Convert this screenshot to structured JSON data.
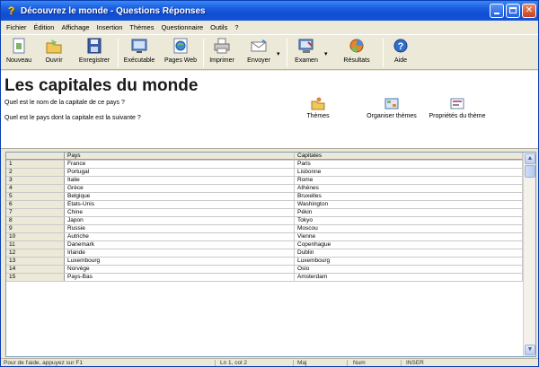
{
  "window": {
    "title": "Découvrez le monde - Questions Réponses",
    "icon": "question-mark-icon"
  },
  "menu": [
    "Fichier",
    "Édition",
    "Affichage",
    "Insertion",
    "Thèmes",
    "Questionnaire",
    "Outils",
    "?"
  ],
  "toolbar": {
    "buttons": [
      {
        "label": "Nouveau",
        "icon": "new-document-icon"
      },
      {
        "label": "Ouvrir",
        "icon": "open-folder-icon"
      },
      {
        "label": "Enregistrer",
        "icon": "save-disk-icon"
      },
      {
        "label": "Exécutable",
        "icon": "executable-icon"
      },
      {
        "label": "Pages Web",
        "icon": "web-pages-icon"
      },
      {
        "label": "Imprimer",
        "icon": "printer-icon"
      },
      {
        "label": "Envoyer",
        "icon": "send-mail-icon"
      },
      {
        "label": "Examen",
        "icon": "exam-icon"
      },
      {
        "label": "Résultats",
        "icon": "results-icon"
      },
      {
        "label": "Aide",
        "icon": "help-icon"
      }
    ]
  },
  "header": {
    "title": "Les capitales du monde",
    "question1": "Quel est le nom de la capitale de ce pays ?",
    "question2": "Quel est le pays dont la capitale est la suivante ?",
    "buttons": [
      {
        "label": "Thèmes",
        "icon": "themes-icon"
      },
      {
        "label": "Organiser thèmes",
        "icon": "organize-themes-icon"
      },
      {
        "label": "Propriétés du thème",
        "icon": "theme-properties-icon"
      }
    ]
  },
  "grid": {
    "columns": [
      "",
      "Pays",
      "Capitales"
    ],
    "rows": [
      [
        "1",
        "France",
        "Paris"
      ],
      [
        "2",
        "Portugal",
        "Lisbonne"
      ],
      [
        "3",
        "Italie",
        "Rome"
      ],
      [
        "4",
        "Grèce",
        "Athènes"
      ],
      [
        "5",
        "Belgique",
        "Bruxelles"
      ],
      [
        "6",
        "États-Unis",
        "Washington"
      ],
      [
        "7",
        "Chine",
        "Pékin"
      ],
      [
        "8",
        "Japon",
        "Tokyo"
      ],
      [
        "9",
        "Russie",
        "Moscou"
      ],
      [
        "10",
        "Autriche",
        "Vienne"
      ],
      [
        "11",
        "Danemark",
        "Copenhague"
      ],
      [
        "12",
        "Irlande",
        "Dublin"
      ],
      [
        "13",
        "Luxembourg",
        "Luxembourg"
      ],
      [
        "14",
        "Norvège",
        "Oslo"
      ],
      [
        "15",
        "Pays-Bas",
        "Amsterdam"
      ]
    ]
  },
  "status": {
    "help": "Pour de l'aide, appuyez sur F1",
    "position": "Ln 1, col 2",
    "cells": [
      "Maj",
      "Num",
      "INSER"
    ]
  }
}
